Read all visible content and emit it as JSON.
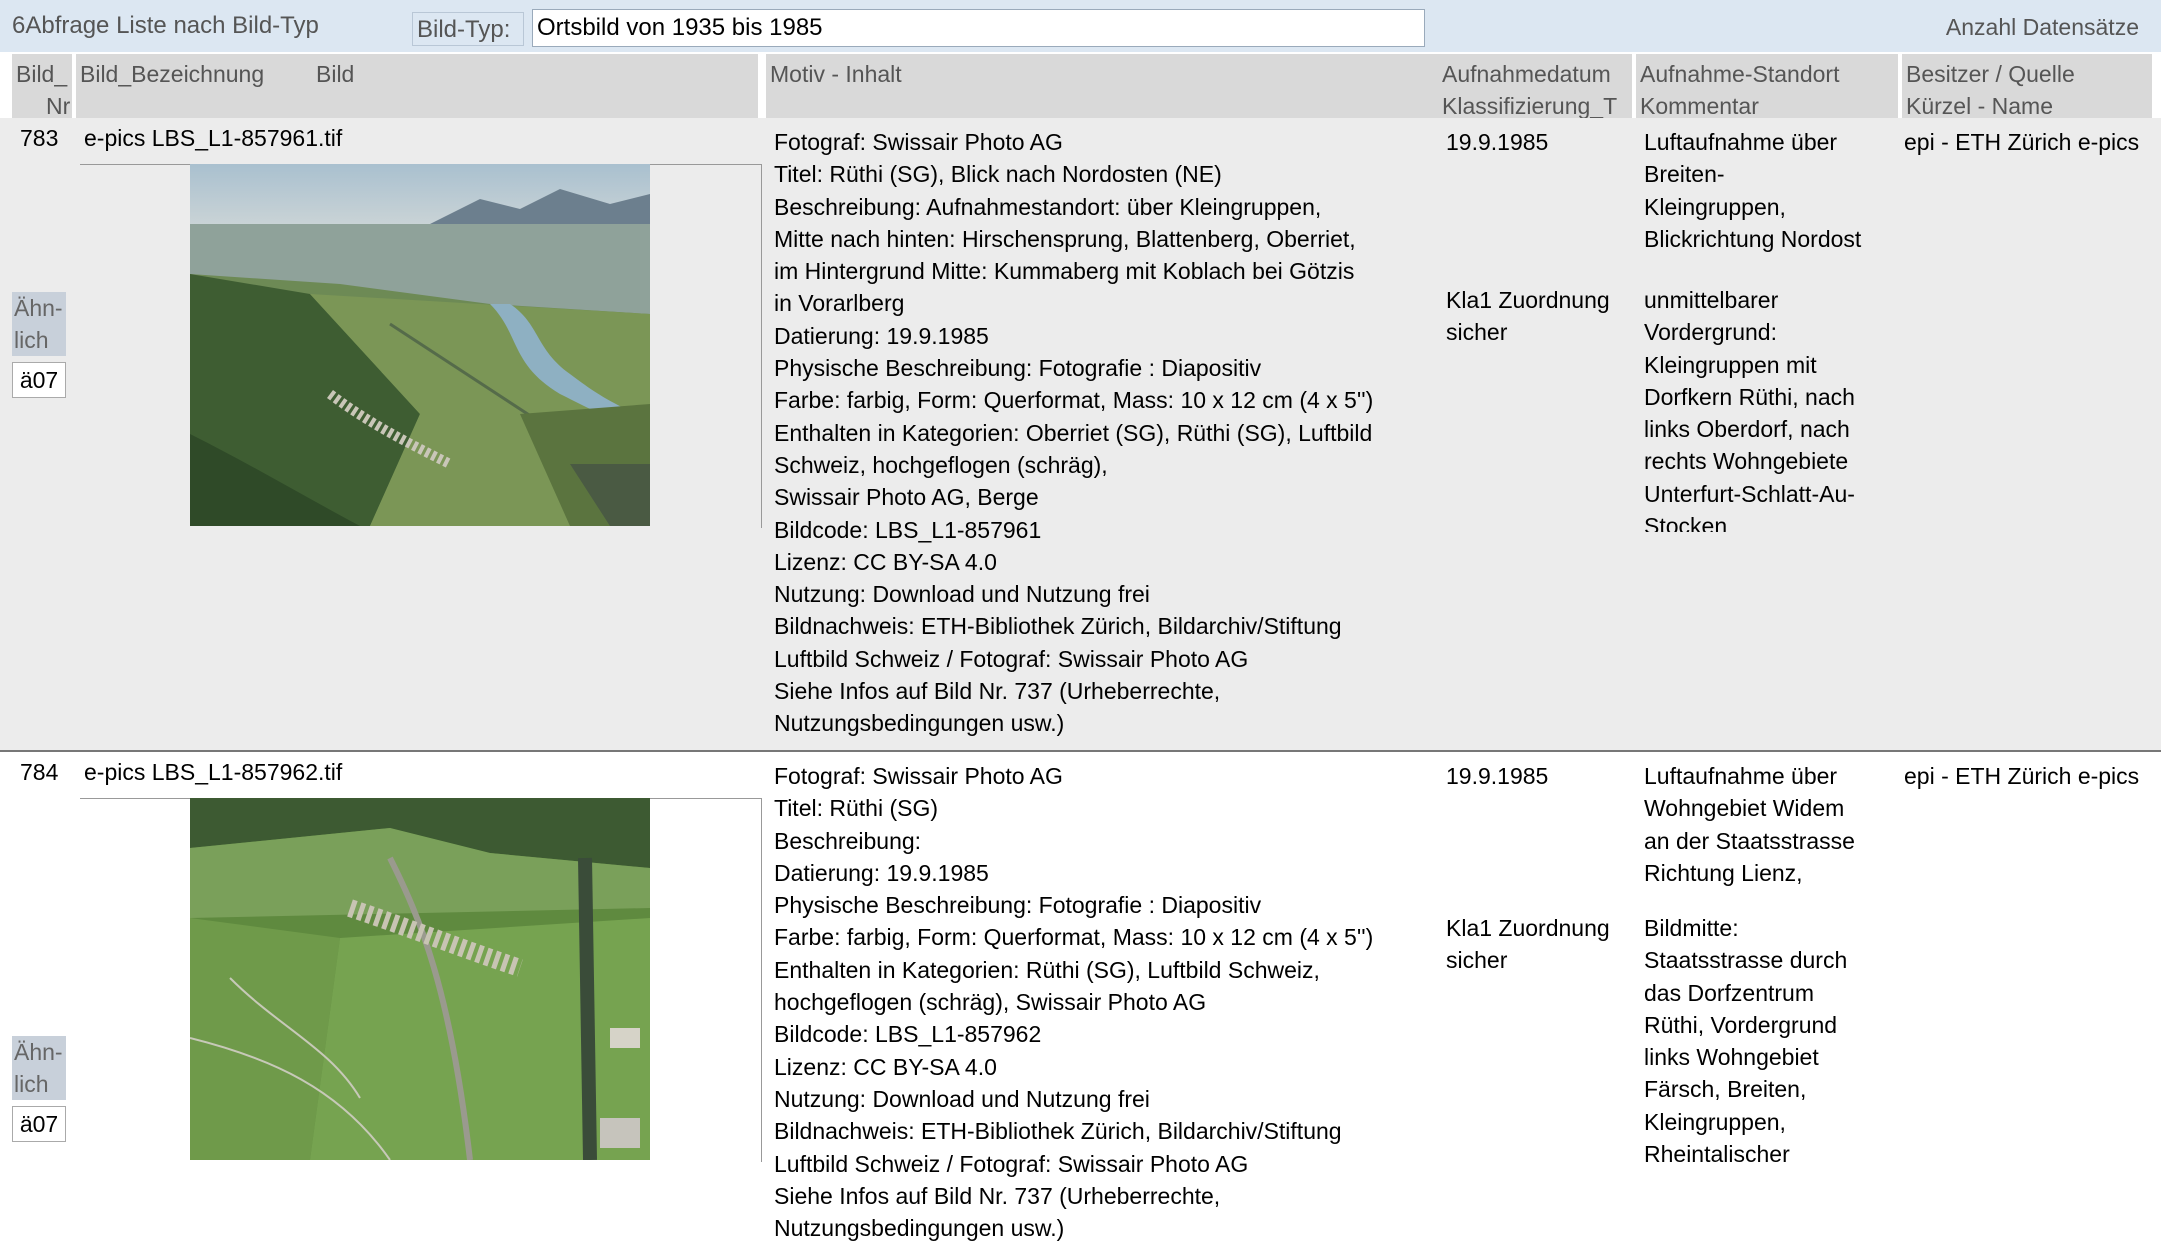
{
  "header": {
    "form_title": "6Abfrage Liste nach Bild-Typ",
    "filter_label": "Bild-Typ:",
    "filter_value": "Ortsbild von 1935 bis 1985",
    "count_label": "Anzahl Datensätze"
  },
  "columns": {
    "bild_nr": [
      "Bild_",
      "Nr"
    ],
    "bezeichnung": "Bild_Bezeichnung",
    "bild": "Bild",
    "motiv": "Motiv - Inhalt",
    "aufnahmedatum": [
      "Aufnahmedatum",
      "Klassifizierung_T"
    ],
    "standort": [
      "Aufnahme-Standort",
      "Kommentar"
    ],
    "besitzer": [
      "Besitzer / Quelle",
      "Kürzel - Name"
    ]
  },
  "records": [
    {
      "nr": "783",
      "filename": "e-pics LBS_L1-857961.tif",
      "similar_label": [
        "Ähn-",
        "lich"
      ],
      "similar_code": "ä07",
      "motiv": [
        "Fotograf: Swissair Photo AG",
        "Titel: Rüthi (SG), Blick nach Nordosten (NE)",
        "Beschreibung: Aufnahmestandort: über Kleingruppen,",
        "Mitte nach hinten: Hirschensprung, Blattenberg, Oberriet,",
        "im Hintergrund Mitte: Kummaberg mit Koblach bei Götzis",
        "in Vorarlberg",
        "Datierung: 19.9.1985",
        "Physische Beschreibung: Fotografie : Diapositiv",
        "Farbe: farbig, Form: Querformat, Mass: 10 x 12 cm (4 x 5'')",
        "Enthalten in Kategorien: Oberriet (SG), Rüthi (SG), Luftbild",
        "Schweiz, hochgeflogen (schräg),",
        "Swissair Photo AG, Berge",
        "Bildcode: LBS_L1-857961",
        "Lizenz: CC BY-SA 4.0",
        "Nutzung: Download und Nutzung frei",
        "Bildnachweis: ETH-Bibliothek Zürich, Bildarchiv/Stiftung",
        "Luftbild Schweiz / Fotograf: Swissair Photo AG",
        "Siehe Infos auf Bild Nr. 737 (Urheberrechte,",
        "Nutzungsbedingungen usw.)"
      ],
      "datum": "19.9.1985",
      "klassifizierung": [
        "Kla1 Zuordnung",
        "sicher"
      ],
      "standort": [
        "Luftaufnahme über",
        "Breiten-",
        "Kleingruppen,",
        "Blickrichtung Nordost"
      ],
      "kommentar": [
        "unmittelbarer",
        "Vordergrund:",
        "Kleingruppen mit",
        "Dorfkern Rüthi, nach",
        "links Oberdorf, nach",
        "rechts Wohngebiete",
        "Unterfurt-Schlatt-Au-",
        "Stocken"
      ],
      "besitzer": "epi -  ETH Zürich e-pics"
    },
    {
      "nr": "784",
      "filename": "e-pics LBS_L1-857962.tif",
      "similar_label": [
        "Ähn-",
        "lich"
      ],
      "similar_code": "ä07",
      "motiv": [
        "Fotograf: Swissair Photo AG",
        "Titel: Rüthi (SG)",
        "Beschreibung:",
        "Datierung: 19.9.1985",
        "Physische Beschreibung: Fotografie : Diapositiv",
        "Farbe: farbig, Form: Querformat, Mass: 10 x 12 cm (4 x 5'')",
        "Enthalten in Kategorien: Rüthi (SG), Luftbild Schweiz,",
        "hochgeflogen (schräg), Swissair Photo AG",
        "Bildcode: LBS_L1-857962",
        "Lizenz: CC BY-SA 4.0",
        "Nutzung: Download und Nutzung frei",
        "Bildnachweis: ETH-Bibliothek Zürich, Bildarchiv/Stiftung",
        "Luftbild Schweiz / Fotograf: Swissair Photo AG",
        "Siehe Infos auf Bild Nr. 737 (Urheberrechte,",
        "Nutzungsbedingungen usw.)"
      ],
      "datum": "19.9.1985",
      "klassifizierung": [
        "Kla1 Zuordnung",
        "sicher"
      ],
      "standort": [
        "Luftaufnahme über",
        "Wohngebiet Widem",
        "an der Staatsstrasse",
        "Richtung Lienz,"
      ],
      "kommentar": [
        "Bildmitte:",
        "Staatsstrasse durch",
        "das Dorfzentrum",
        "Rüthi, Vordergrund",
        "links Wohngebiet",
        "Färsch, Breiten,",
        "Kleingruppen,",
        "Rheintalischer"
      ],
      "besitzer": "epi -  ETH Zürich e-pics"
    }
  ]
}
